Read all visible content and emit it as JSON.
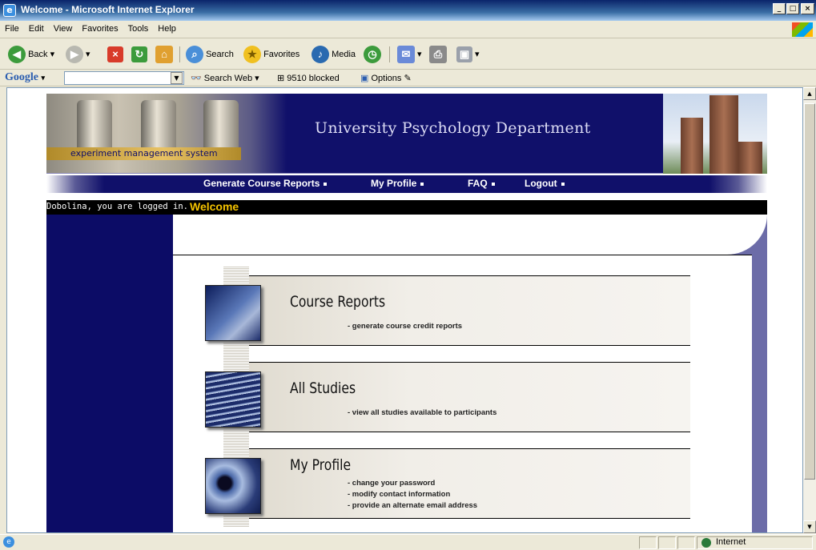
{
  "window": {
    "title": "Welcome - Microsoft Internet Explorer",
    "min": "_",
    "max": "□",
    "close": "×"
  },
  "menu": [
    "File",
    "Edit",
    "View",
    "Favorites",
    "Tools",
    "Help"
  ],
  "toolbar": {
    "back": "Back",
    "search": "Search",
    "favorites": "Favorites",
    "media": "Media"
  },
  "googlebar": {
    "logo": "Google",
    "search_web": "Search Web",
    "blocked": "9510 blocked",
    "options": "Options"
  },
  "page": {
    "banner_title": "University Psychology Department",
    "banner_subtitle": "experiment management system",
    "nav": [
      "Generate Course Reports",
      "My Profile",
      "FAQ",
      "Logout"
    ],
    "login_status": "Dobolina, you are logged in.",
    "heading": "Welcome",
    "sections": [
      {
        "title": "Course Reports",
        "lines": [
          "- generate course credit reports"
        ]
      },
      {
        "title": "All Studies",
        "lines": [
          "- view all studies available to participants"
        ]
      },
      {
        "title": "My Profile",
        "lines": [
          "- change your password",
          "- modify contact information",
          "- provide an alternate email address"
        ]
      }
    ]
  },
  "statusbar": {
    "zone": "Internet"
  }
}
